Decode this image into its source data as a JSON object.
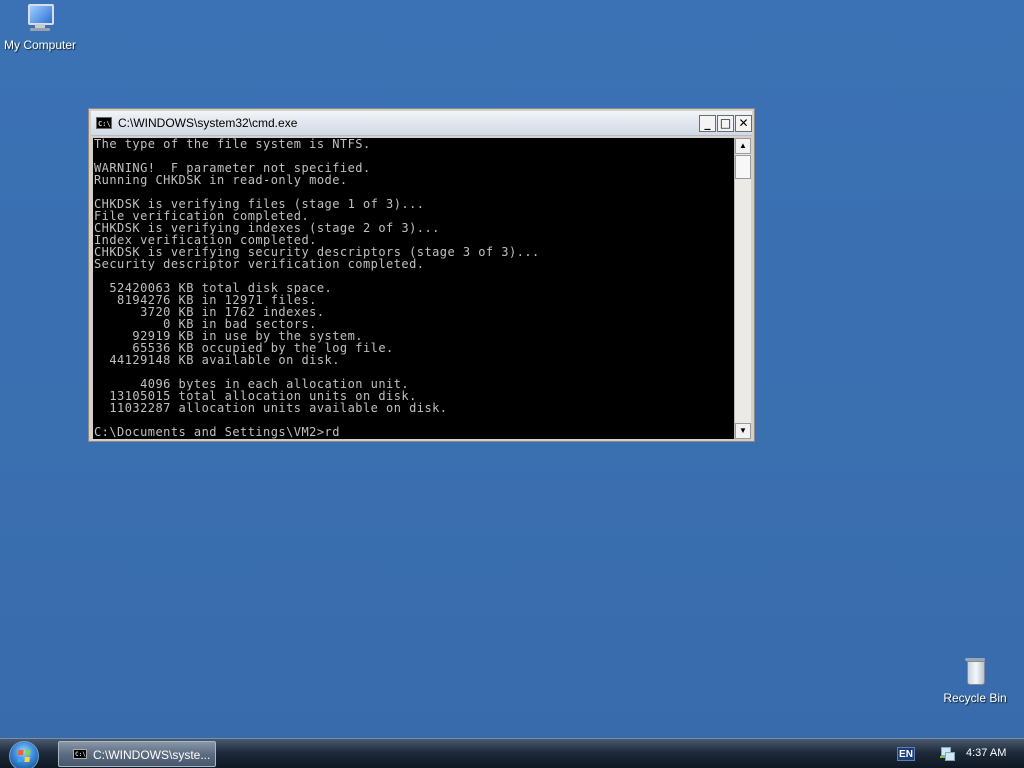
{
  "desktop": {
    "icons": [
      {
        "label": "My Computer",
        "icon": "computer-icon"
      },
      {
        "label": "Recycle Bin",
        "icon": "recycle-bin-icon"
      }
    ]
  },
  "window": {
    "title": "C:\\WINDOWS\\system32\\cmd.exe",
    "icon_text": "C:\\",
    "buttons": {
      "minimize": "_",
      "maximize": "□",
      "close": "✕"
    },
    "console_lines": [
      "The type of the file system is NTFS.",
      "",
      "WARNING!  F parameter not specified.",
      "Running CHKDSK in read-only mode.",
      "",
      "CHKDSK is verifying files (stage 1 of 3)...",
      "File verification completed.",
      "CHKDSK is verifying indexes (stage 2 of 3)...",
      "Index verification completed.",
      "CHKDSK is verifying security descriptors (stage 3 of 3)...",
      "Security descriptor verification completed.",
      "",
      "  52420063 KB total disk space.",
      "   8194276 KB in 12971 files.",
      "      3720 KB in 1762 indexes.",
      "         0 KB in bad sectors.",
      "     92919 KB in use by the system.",
      "     65536 KB occupied by the log file.",
      "  44129148 KB available on disk.",
      "",
      "      4096 bytes in each allocation unit.",
      "  13105015 total allocation units on disk.",
      "  11032287 allocation units available on disk.",
      "",
      "C:\\Documents and Settings\\VM2>rd"
    ],
    "scrollbar": {
      "up": "▲",
      "down": "▼"
    }
  },
  "taskbar": {
    "task_label": "C:\\WINDOWS\\syste...",
    "task_icon_text": "C:\\",
    "language": "EN",
    "clock": "4:37 AM"
  }
}
